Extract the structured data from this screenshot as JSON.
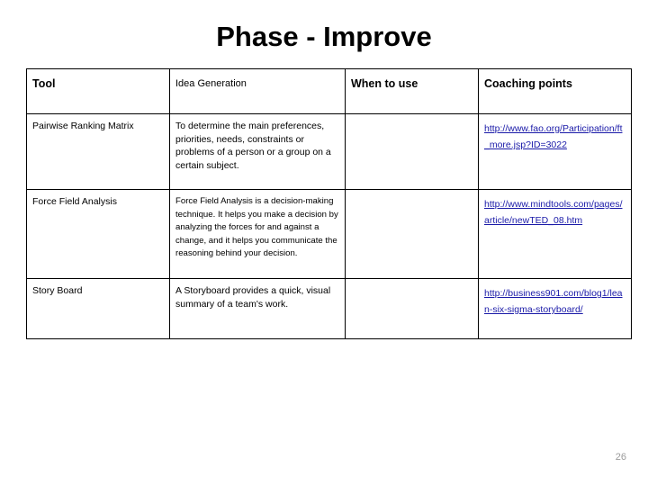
{
  "slide": {
    "title": "Phase - Improve",
    "page_number": "26",
    "link_color": "#1a1aa8",
    "page_number_color": "#9a9a9a"
  },
  "table": {
    "headers": {
      "tool": "Tool",
      "idea_generation": "Idea Generation",
      "when_to_use": "When to use",
      "coaching_points": "Coaching points"
    },
    "rows": [
      {
        "tool": "Pairwise Ranking Matrix",
        "description": "To determine the main preferences, priorities, needs, constraints or problems of a person or a group on a certain subject.",
        "when_to_use": "",
        "coaching_points": "http://www.fao.org/Participation/ft_more.jsp?ID=3022"
      },
      {
        "tool": "Force Field Analysis",
        "description": "Force Field Analysis is a decision-making technique. It helps you make a decision by analyzing the forces for and against a change, and it helps you communicate the reasoning behind your decision.",
        "when_to_use": "",
        "coaching_points": "http://www.mindtools.com/pages/article/newTED_08.htm"
      },
      {
        "tool": "Story Board",
        "description": "A Storyboard provides a quick, visual summary of a team's work.",
        "when_to_use": "",
        "coaching_points": "http://business901.com/blog1/lean-six-sigma-storyboard/"
      }
    ]
  }
}
